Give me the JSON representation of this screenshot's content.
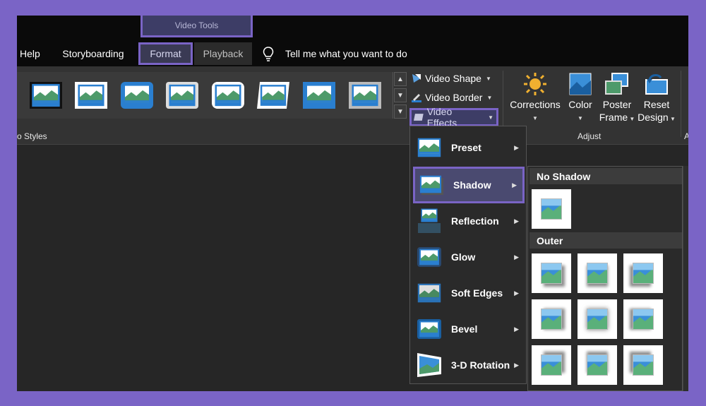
{
  "context_tab": "Video Tools",
  "tabs": {
    "help": "Help",
    "storyboarding": "Storyboarding",
    "format": "Format",
    "playback": "Playback"
  },
  "tell_me": "Tell me what you want to do",
  "ribbon": {
    "styles_group_label": "o Styles",
    "adjust_group_label": "Adjust",
    "video_shape": "Video Shape",
    "video_border": "Video Border",
    "video_effects": "Video Effects",
    "corrections": "Corrections",
    "color": "Color",
    "poster_frame": [
      "Poster",
      "Frame"
    ],
    "reset_design": [
      "Reset",
      "Design"
    ],
    "trailing_label": "A"
  },
  "effects_menu": [
    {
      "label": "Preset",
      "icon": "preset-effect-icon"
    },
    {
      "label": "Shadow",
      "icon": "shadow-effect-icon"
    },
    {
      "label": "Reflection",
      "icon": "reflection-effect-icon"
    },
    {
      "label": "Glow",
      "icon": "glow-effect-icon"
    },
    {
      "label": "Soft Edges",
      "icon": "soft-edges-effect-icon"
    },
    {
      "label": "Bevel",
      "icon": "bevel-effect-icon"
    },
    {
      "label": "3-D Rotation",
      "icon": "3d-rotation-effect-icon"
    }
  ],
  "shadow_panel": {
    "no_shadow_header": "No Shadow",
    "outer_header": "Outer"
  },
  "colors": {
    "accent": "#7a64c6",
    "ribbon": "#333333",
    "tab_bar": "#0a0a0a"
  }
}
